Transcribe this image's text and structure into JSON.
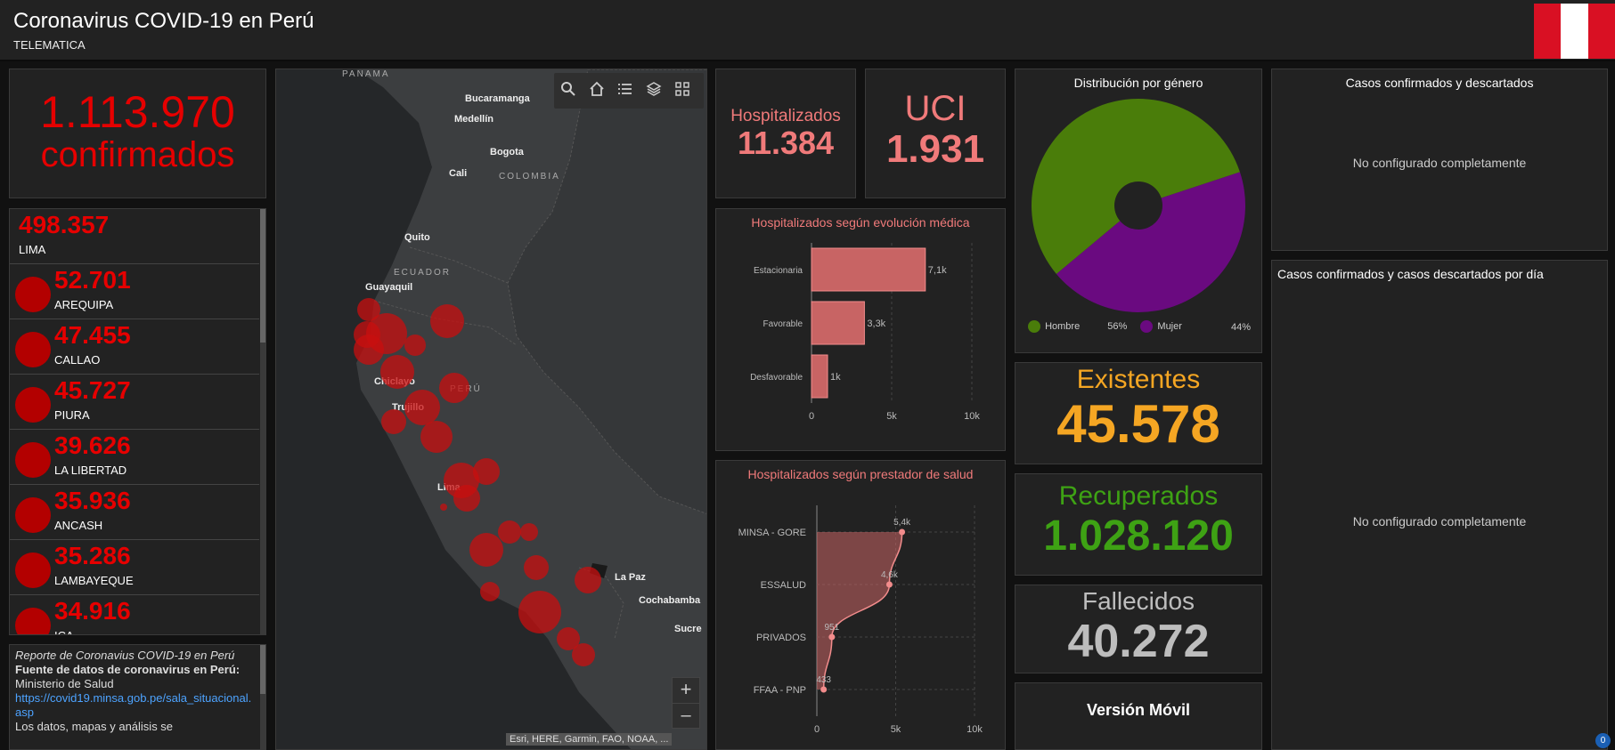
{
  "header": {
    "title": "Coronavirus COVID-19 en Perú",
    "subtitle": "TELEMATICA"
  },
  "colors": {
    "flag_red": "#d91023",
    "flag_white": "#ffffff",
    "confirmed": "#e60000",
    "hospital": "#f07a7a",
    "existentes": "#f5a623",
    "recuperados": "#3ea214",
    "fallecidos": "#bdbdbd",
    "hombre": "#4a7d0a",
    "mujer": "#6a0a80"
  },
  "confirmed": {
    "value": "1.113.970",
    "label": "confirmados"
  },
  "regions": [
    {
      "value": "498.357",
      "label": "LIMA"
    },
    {
      "value": "52.701",
      "label": "AREQUIPA"
    },
    {
      "value": "47.455",
      "label": "CALLAO"
    },
    {
      "value": "45.727",
      "label": "PIURA"
    },
    {
      "value": "39.626",
      "label": "LA LIBERTAD"
    },
    {
      "value": "35.936",
      "label": "ANCASH"
    },
    {
      "value": "35.286",
      "label": "LAMBAYEQUE"
    },
    {
      "value": "34.916",
      "label": "ICA"
    }
  ],
  "report": {
    "title": "Reporte de Coronavius COVID-19 en Perú",
    "source_label": "Fuente de datos de coronavirus en Perú:",
    "source": " Ministerio de Salud",
    "link": "https://covid19.minsa.gob.pe/sala_situacional.asp",
    "note": "Los datos, mapas y análisis se"
  },
  "map": {
    "labels": [
      "PANAMA",
      "Bucaramanga",
      "Medellín",
      "Bogota",
      "Cali",
      "COLOMBIA",
      "Quito",
      "ECUADOR",
      "Guayaquil",
      "Chiclayo",
      "PERÚ",
      "Trujillo",
      "Lima",
      "La Paz",
      "Cochabamba",
      "Sucre"
    ],
    "attribution": "Esri, HERE, Garmin, FAO, NOAA, ...",
    "icons": [
      "search-icon",
      "home-icon",
      "list-icon",
      "layers-icon",
      "qr-icon"
    ],
    "zoom_in": "+",
    "zoom_out": "–"
  },
  "hospitalizados": {
    "label": "Hospitalizados",
    "value": "11.384"
  },
  "uci": {
    "label": "UCI",
    "value": "1.931"
  },
  "evolucion_title": "Hospitalizados según evolución médica",
  "prestador_title": "Hospitalizados según prestador de salud",
  "genero": {
    "title": "Distribución por género",
    "hombre_label": "Hombre",
    "hombre_pct": "56%",
    "mujer_label": "Mujer",
    "mujer_pct": "44%"
  },
  "existentes": {
    "label": "Existentes",
    "value": "45.578"
  },
  "recuperados": {
    "label": "Recuperados",
    "value": "1.028.120"
  },
  "fallecidos": {
    "label": "Fallecidos",
    "value": "40.272"
  },
  "movil": {
    "label": "Versión Móvil"
  },
  "casos": {
    "title": "Casos confirmados y descartados",
    "msg": "No configurado completamente"
  },
  "casos_dia": {
    "title": "Casos confirmados y casos descartados por día",
    "msg": "No configurado completamente"
  },
  "notification": {
    "count": "0"
  },
  "chart_data": [
    {
      "type": "bar",
      "title": "Hospitalizados según evolución médica",
      "categories": [
        "Estacionaria",
        "Favorable",
        "Desfavorable"
      ],
      "values": [
        7100,
        3300,
        1000
      ],
      "labels": [
        "7,1k",
        "3,3k",
        "1k"
      ],
      "xticks": [
        "0",
        "5k",
        "10k"
      ],
      "xlim": [
        0,
        10000
      ]
    },
    {
      "type": "area",
      "title": "Hospitalizados según prestador de salud",
      "categories": [
        "MINSA - GORE",
        "ESSALUD",
        "PRIVADOS",
        "FFAA - PNP"
      ],
      "values": [
        5400,
        4600,
        951,
        433
      ],
      "labels": [
        "5,4k",
        "4,6k",
        "951",
        "433"
      ],
      "xticks": [
        "0",
        "5k",
        "10k"
      ],
      "xlim": [
        0,
        10000
      ]
    },
    {
      "type": "pie",
      "title": "Distribución por género",
      "categories": [
        "Hombre",
        "Mujer"
      ],
      "values": [
        56,
        44
      ]
    }
  ]
}
